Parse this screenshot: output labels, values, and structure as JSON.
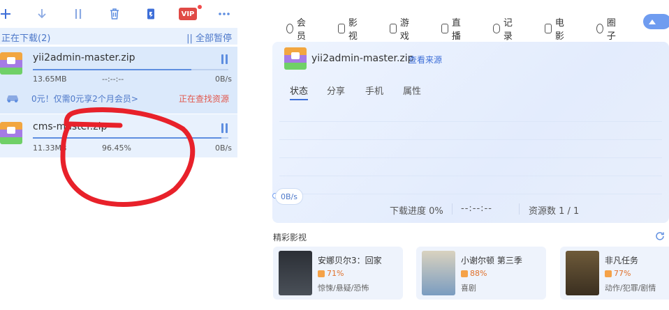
{
  "toolbar": {
    "icons": [
      "add-icon",
      "download-icon",
      "pause-icon",
      "delete-icon",
      "phone-icon",
      "vip-icon",
      "more-icon"
    ],
    "vip_label": "VIP",
    "accent": "#3e6fd8"
  },
  "downloads": {
    "section_title": "正在下载(2)",
    "pause_all": "|| 全部暂停",
    "items": [
      {
        "name": "yii2admin-master.zip",
        "size": "13.65MB",
        "progress_text": "--:--:--",
        "progress_fraction": 0.81,
        "speed": "0B/s",
        "promo": "0元！仅需0元享2个月会员>",
        "status": "正在查找资源"
      },
      {
        "name": "cms-master.zip",
        "size": "11.33MB",
        "progress_text": "96.45%",
        "progress_fraction": 0.9645,
        "speed": "0B/s"
      }
    ]
  },
  "nav": {
    "items": [
      "会员",
      "影视",
      "游戏",
      "直播",
      "记录",
      "电影",
      "圈子"
    ]
  },
  "detail": {
    "file_name": "yii2admin-master.zip",
    "source_link": "查看来源",
    "tabs": [
      "状态",
      "分享",
      "手机",
      "属性"
    ],
    "active_tab": "状态",
    "speed": "0B/s",
    "progress_label": "下载进度 0%",
    "time_left": "--:--:--",
    "sources": "资源数 1 / 1"
  },
  "featured": {
    "title": "精彩影视",
    "videos": [
      {
        "title": "安娜贝尔3：回家",
        "score": "71%",
        "genre": "惊悚/悬疑/恐怖",
        "poster_color": "#2c3a44"
      },
      {
        "title": "小谢尔顿 第三季",
        "score": "88%",
        "genre": "喜剧",
        "poster_color": "#6b8fb5"
      },
      {
        "title": "非凡任务",
        "score": "77%",
        "genre": "动作/犯罪/剧情",
        "poster_color": "#5a4a32"
      }
    ]
  },
  "colors": {
    "annotation_red": "#e8212a",
    "status_red": "#e2584d",
    "panel_bg": "#e8f1fd"
  }
}
